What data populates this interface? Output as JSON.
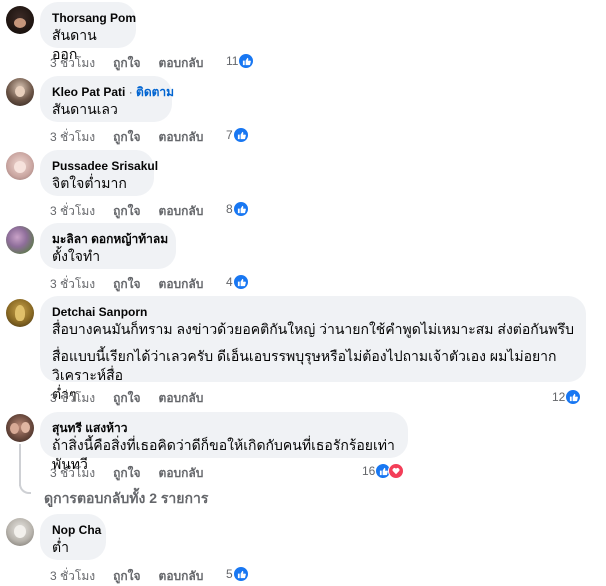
{
  "comments": [
    {
      "name": "Thorsang Pom",
      "text": "สันดาน ออก",
      "time": "3 ชั่วโมง",
      "like": "ถูกใจ",
      "reply": "ตอบกลับ",
      "count": "11"
    },
    {
      "name": "Kleo Pat Pati",
      "follow": "ติดตาม",
      "text": "สันดานเลว",
      "time": "3 ชั่วโมง",
      "like": "ถูกใจ",
      "reply": "ตอบกลับ",
      "count": "7"
    },
    {
      "name": "Pussadee Srisakul",
      "text": "จิตใจต่ำมาก",
      "time": "3 ชั่วโมง",
      "like": "ถูกใจ",
      "reply": "ตอบกลับ",
      "count": "8"
    },
    {
      "name": "มะลิลา ดอกหญ้าท้าลม",
      "text": "ตั้งใจทำ",
      "time": "3 ชั่วโมง",
      "like": "ถูกใจ",
      "reply": "ตอบกลับ",
      "count": "4"
    },
    {
      "name": "Detchai Sanporn",
      "text1": "สื่อบางคนมันก็ทราม ลงข่าวด้วยอคติกันใหญ่ ว่านายกใช้คำพูดไม่เหมาะสม ส่งต่อกันพรึบ",
      "text2": "สื่อแบบนี้เรียกได้ว่าเลวครับ ดีเอ็นเอบรรพบุรุษหรือไม่ต้องไปถามเจ้าตัวเอง ผมไม่อยากวิเคราะห์สื่อ",
      "text3": "ต่ำๆ",
      "time": "3 ชั่วโมง",
      "like": "ถูกใจ",
      "reply": "ตอบกลับ",
      "count": "12"
    },
    {
      "name": "สุนทรี แสงห้าว",
      "text": "ถ้าสิ่งนี้คือสิ่งที่เธอคิดว่าดีก็ขอให้เกิดกับคนที่เธอรักร้อยเท่าพันทวี",
      "time": "3 ชั่วโมง",
      "like": "ถูกใจ",
      "reply": "ตอบกลับ",
      "count": "16"
    },
    {
      "name": "Nop Cha",
      "text": "ต่ำ",
      "time": "3 ชั่วโมง",
      "like": "ถูกใจ",
      "reply": "ตอบกลับ",
      "count": "5"
    }
  ],
  "view_replies": "ดูการตอบกลับทั้ง 2 รายการ",
  "colors": {
    "like_blue": "#1877f2",
    "love_red": "#f33e58",
    "bubble": "#f0f2f5",
    "meta": "#65676b"
  }
}
